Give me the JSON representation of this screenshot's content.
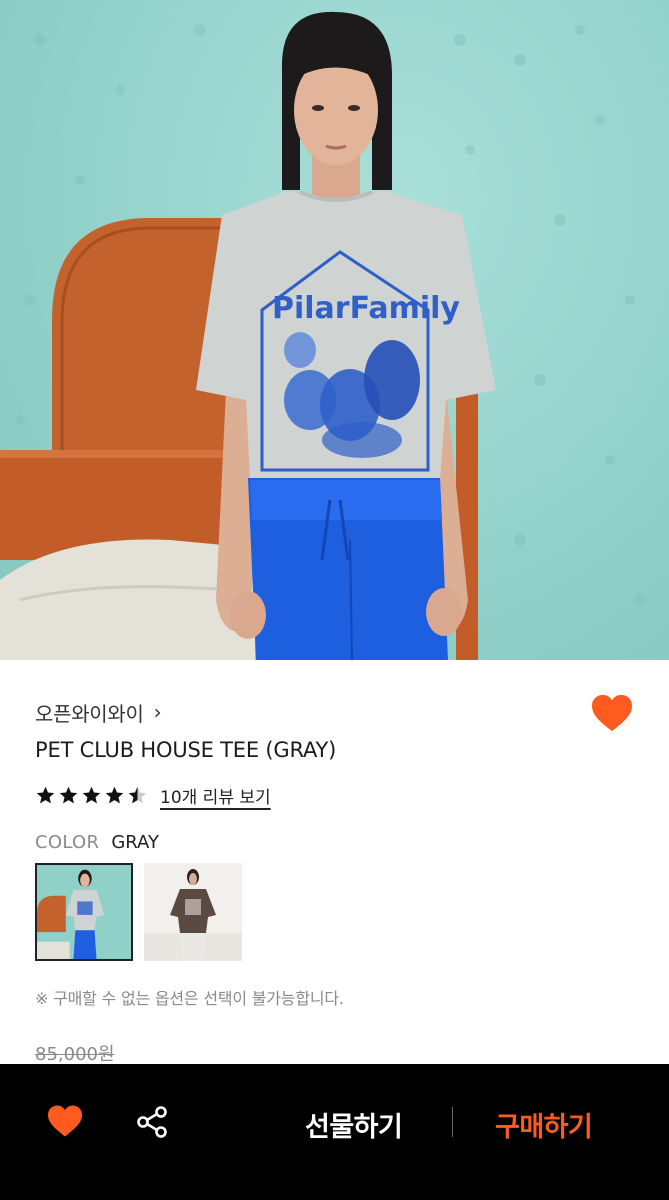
{
  "hero": {
    "image_name": "product-photo",
    "shirt_print": "PilarFamily"
  },
  "product": {
    "brand": "오픈와이와이",
    "name": "PET CLUB HOUSE TEE (GRAY)",
    "rating": 4.5,
    "review_link": "10개 리뷰 보기",
    "color_label": "COLOR",
    "color_value": "GRAY",
    "notice": "※ 구매할 수 없는 옵션은 선택이 불가능합니다.",
    "original_price": "85,000원"
  },
  "bottom_bar": {
    "gift_label": "선물하기",
    "buy_label": "구매하기"
  },
  "colors": {
    "accent": "#ff5a1f",
    "bar_bg": "#000000",
    "muted_text": "#8a8a8a"
  },
  "icons": {
    "wish": "heart-icon",
    "chevron": "chevron-right-icon",
    "share": "share-icon",
    "star": "star-icon"
  }
}
